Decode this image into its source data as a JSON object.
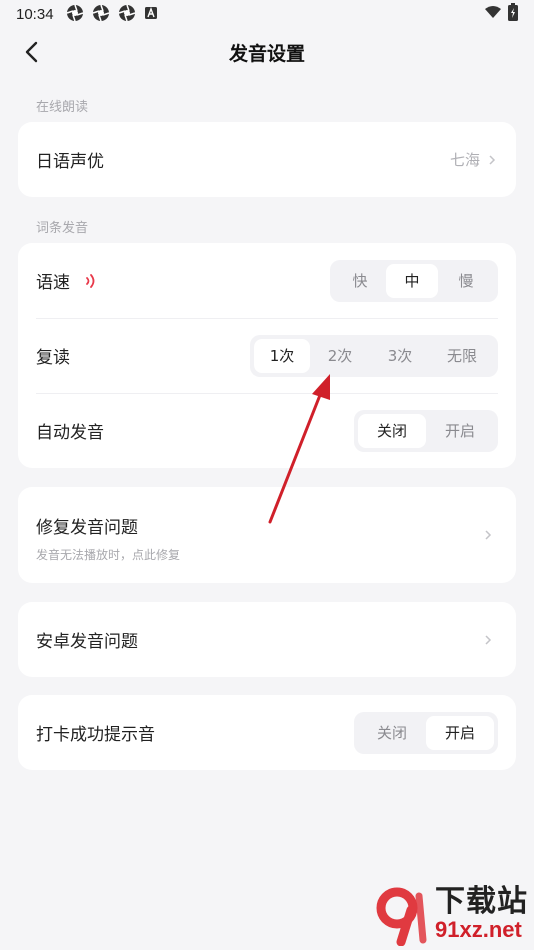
{
  "status_bar": {
    "time": "10:34",
    "icons": [
      "aperture-icon",
      "aperture-icon",
      "aperture-icon",
      "a-badge-icon",
      "wifi-icon",
      "battery-icon"
    ]
  },
  "header": {
    "title": "发音设置",
    "back_icon": "chevron-left-icon"
  },
  "sections": {
    "online_reading": {
      "label": "在线朗读",
      "voice_label": "日语声优",
      "voice_value": "七海"
    },
    "entry_pronunciation": {
      "label": "词条发音",
      "speed": {
        "label": "语速",
        "options": [
          "快",
          "中",
          "慢"
        ],
        "selected": "中"
      },
      "repeat": {
        "label": "复读",
        "options": [
          "1次",
          "2次",
          "3次",
          "无限"
        ],
        "selected": "1次"
      },
      "auto_play": {
        "label": "自动发音",
        "options": [
          "关闭",
          "开启"
        ],
        "selected": "关闭"
      }
    }
  },
  "fix_issue": {
    "title": "修复发音问题",
    "subtitle": "发音无法播放时，点此修复"
  },
  "android_issue": {
    "title": "安卓发音问题"
  },
  "checkin_sound": {
    "label": "打卡成功提示音",
    "options": [
      "关闭",
      "开启"
    ],
    "selected": "开启"
  },
  "watermark": {
    "title": "下载站",
    "url": "91xz.net"
  },
  "colors": {
    "accent_red": "#d0202a",
    "background": "#f5f5f7",
    "card": "#ffffff",
    "segment_bg": "#f2f2f5"
  }
}
